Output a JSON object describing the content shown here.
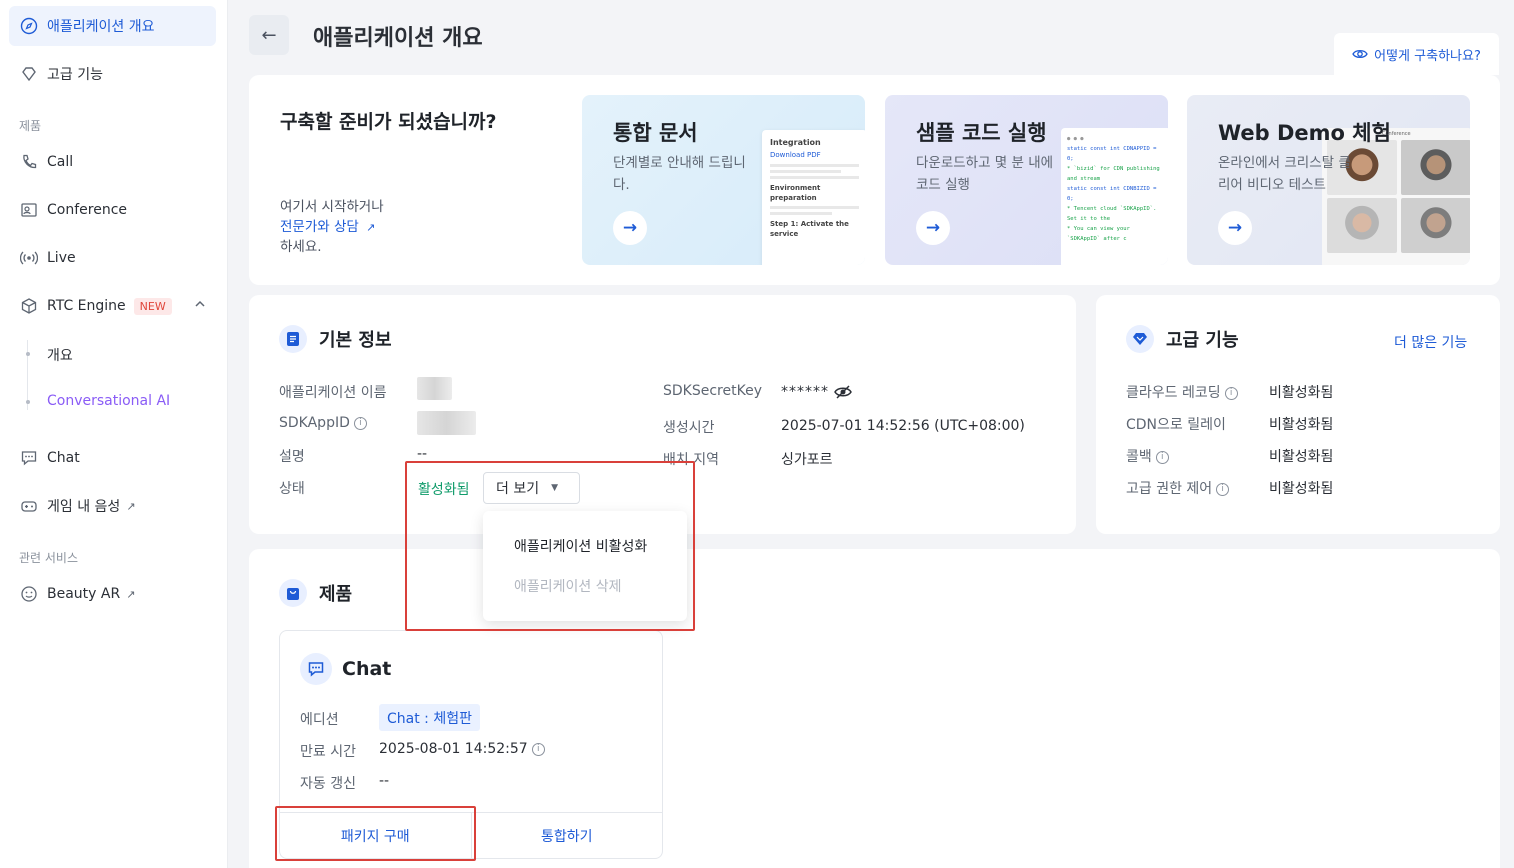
{
  "sidebar": {
    "overview": "애플리케이션 개요",
    "advanced": "고급 기능",
    "section_products": "제품",
    "call": "Call",
    "conference": "Conference",
    "live": "Live",
    "rtc_engine": "RTC Engine",
    "new_badge": "NEW",
    "sub_overview": "개요",
    "sub_conv_ai": "Conversational AI",
    "chat": "Chat",
    "game_voice": "게임 내 음성",
    "section_related": "관련 서비스",
    "beauty_ar": "Beauty AR"
  },
  "header": {
    "title": "애플리케이션 개요",
    "how_to_build": "어떻게 구축하나요?"
  },
  "ready": {
    "title": "구축할 준비가 되셨습니까?",
    "line1": "여기서 시작하거나",
    "link": "전문가와 상담",
    "line3": "하세요."
  },
  "promos": [
    {
      "title": "통합 문서",
      "desc": "단계별로 안내해 드립니다."
    },
    {
      "title": "샘플 코드 실행",
      "desc": "다운로드하고 몇 분 내에 코드 실행"
    },
    {
      "title": "Web Demo 체험",
      "desc": "온라인에서 크리스탈 클리어 비디오 테스트"
    }
  ],
  "doc_preview": {
    "heading": "Integration",
    "link": "Download PDF",
    "sub1": "Environment preparation",
    "sub2": "Step 1: Activate the service"
  },
  "code_preview": {
    "line1": "static const int CDNAPPID = 0;",
    "line2": "* `bizid` for CDN publishing and stream",
    "line3": "static const int CDNBIZID = 0;",
    "line4": "* Tencent cloud `SDKAppID`. Set it to the",
    "line5": "* You can view your `SDKAppID` after c"
  },
  "demo_preview": {
    "label": "Conference"
  },
  "basic_info": {
    "title": "기본 정보",
    "app_name_label": "애플리케이션 이름",
    "sdkappid_label": "SDKAppID",
    "desc_label": "설명",
    "desc_value": "--",
    "status_label": "상태",
    "status_value": "활성화됨",
    "more_button": "더 보기",
    "secret_label": "SDKSecretKey",
    "secret_value": "******",
    "created_label": "생성시간",
    "created_value": "2025-07-01 14:52:56 (UTC+08:00)",
    "region_label": "배치 지역",
    "region_value": "싱가포르"
  },
  "dropdown": {
    "deactivate": "애플리케이션 비활성화",
    "delete": "애플리케이션 삭제"
  },
  "advanced": {
    "title": "고급 기능",
    "more_link": "더 많은 기능",
    "rows": [
      {
        "label": "클라우드 레코딩",
        "value": "비활성화됨"
      },
      {
        "label": "CDN으로 릴레이",
        "value": "비활성화됨"
      },
      {
        "label": "콜백",
        "value": "비활성화됨"
      },
      {
        "label": "고급 권한 제어",
        "value": "비활성화됨"
      }
    ]
  },
  "products": {
    "title": "제품",
    "chat_title": "Chat",
    "edition_label": "에디션",
    "edition_value": "Chat : 체험판",
    "expiry_label": "만료 시간",
    "expiry_value": "2025-08-01 14:52:57",
    "renew_label": "자동 갱신",
    "renew_value": "--",
    "buy_button": "패키지 구매",
    "integrate_button": "통합하기"
  }
}
